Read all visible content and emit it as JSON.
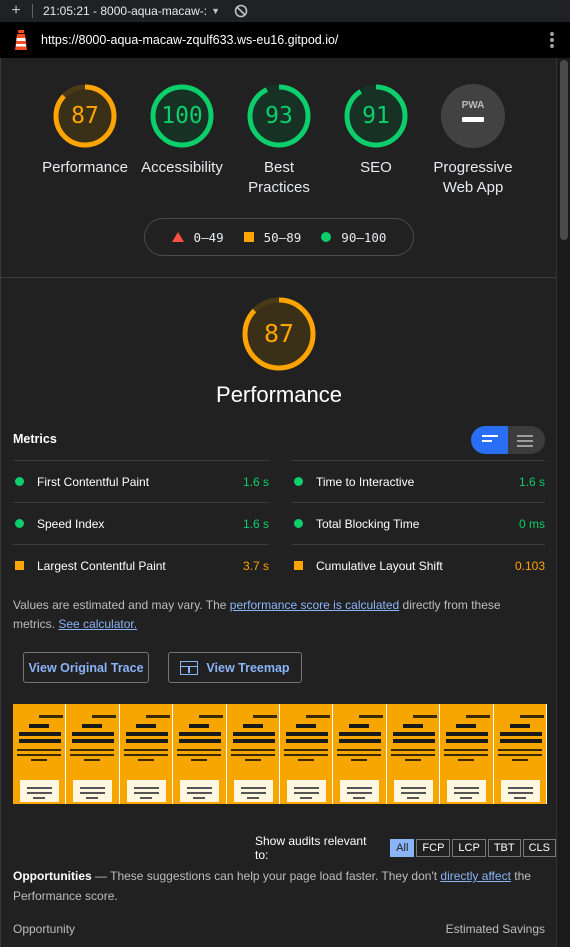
{
  "tab": {
    "title": "21:05:21 - 8000-aqua-macaw-:"
  },
  "url": "https://8000-aqua-macaw-zqulf633.ws-eu16.gitpod.io/",
  "gauges": [
    {
      "score": "87",
      "label": "Performance",
      "level": "average",
      "value": 0.87
    },
    {
      "score": "100",
      "label": "Accessibility",
      "level": "pass",
      "value": 1.0
    },
    {
      "score": "93",
      "label": "Best Practices",
      "level": "pass",
      "value": 0.93
    },
    {
      "score": "91",
      "label": "SEO",
      "level": "pass",
      "value": 0.91
    }
  ],
  "pwa": {
    "label": "Progressive Web App",
    "icon": "PWA"
  },
  "legend": {
    "fail": "0–49",
    "average": "50–89",
    "pass": "90–100"
  },
  "performance": {
    "score": "87",
    "value": 0.87,
    "title": "Performance"
  },
  "metrics": {
    "heading": "Metrics",
    "items": [
      {
        "name": "First Contentful Paint",
        "value": "1.6 s",
        "level": "good"
      },
      {
        "name": "Time to Interactive",
        "value": "1.6 s",
        "level": "good"
      },
      {
        "name": "Speed Index",
        "value": "1.6 s",
        "level": "good"
      },
      {
        "name": "Total Blocking Time",
        "value": "0 ms",
        "level": "good"
      },
      {
        "name": "Largest Contentful Paint",
        "value": "3.7 s",
        "level": "avg"
      },
      {
        "name": "Cumulative Layout Shift",
        "value": "0.103",
        "level": "avg"
      }
    ]
  },
  "note": {
    "prefix": "Values are estimated and may vary. The ",
    "link1": "performance score is calculated",
    "middle": " directly from these metrics. ",
    "link2": "See calculator."
  },
  "buttons": {
    "trace": "View Original Trace",
    "treemap": "View Treemap"
  },
  "filmstrip": {
    "frames": 10
  },
  "audit_filter": {
    "label": "Show audits relevant to:",
    "chips": [
      "All",
      "FCP",
      "LCP",
      "TBT",
      "CLS"
    ],
    "active": "All"
  },
  "opportunities": {
    "title": "Opportunities",
    "text": " — These suggestions can help your page load faster. They don't ",
    "link": "directly affect",
    "suffix": " the Performance score."
  },
  "table": {
    "col1": "Opportunity",
    "col2": "Estimated Savings"
  },
  "colors": {
    "pass": "#0cce6b",
    "average": "#ffa400",
    "fail": "#ff4e42",
    "link": "#8ab4f8"
  }
}
